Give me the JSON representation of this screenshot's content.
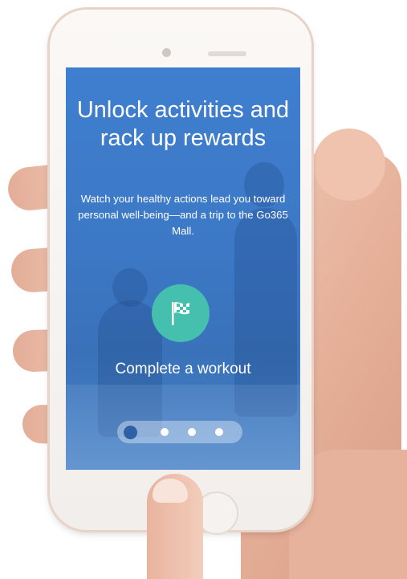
{
  "onboarding": {
    "headline": "Unlock activities and rack up rewards",
    "description": "Watch your healthy actions lead you toward personal well-being—and a trip to the Go365 Mall.",
    "activity": {
      "icon": "checkered-flag-icon",
      "label": "Complete a workout"
    },
    "pager": {
      "page_count": 4,
      "active_page": 1
    }
  },
  "colors": {
    "screen_blue": "#3c78c6",
    "activity_teal": "#45bfae",
    "active_dot": "#2f5fa6"
  }
}
